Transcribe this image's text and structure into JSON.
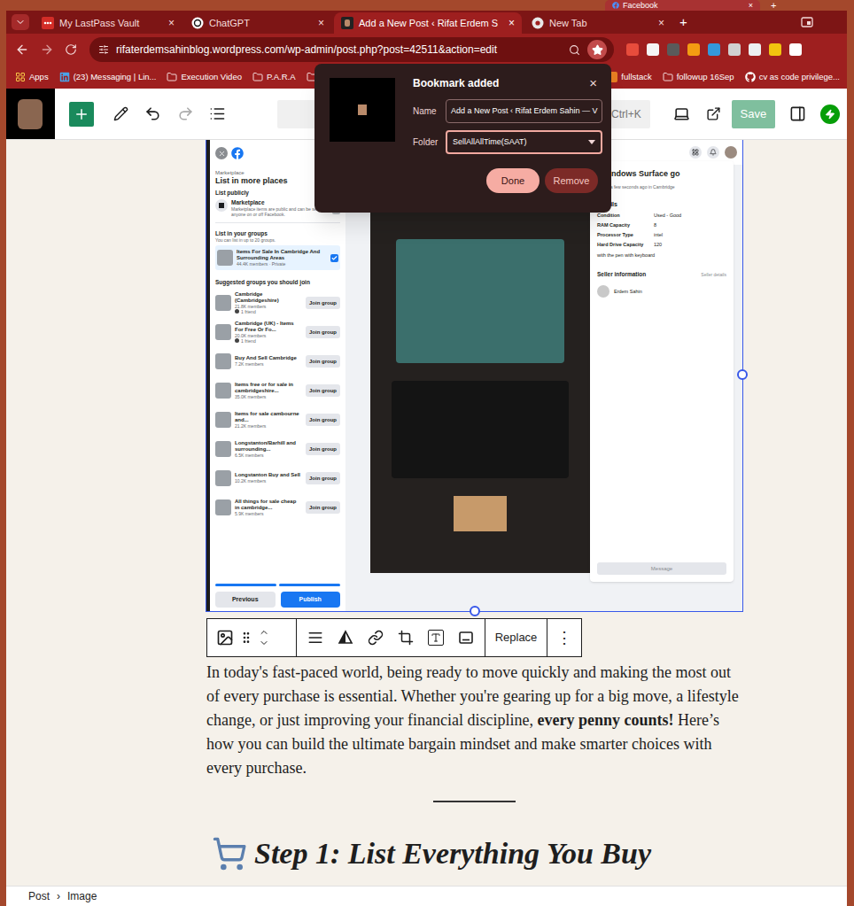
{
  "other_window": {
    "tab": "Facebook",
    "close": "×",
    "new_tab": "+"
  },
  "browser": {
    "tabs": [
      {
        "label": "My LastPass Vault",
        "selected": false
      },
      {
        "label": "ChatGPT",
        "selected": false
      },
      {
        "label": "Add a New Post ‹ Rifat Erdem S",
        "selected": true
      },
      {
        "label": "New Tab",
        "selected": false
      }
    ],
    "tab_close": "×",
    "new_tab": "+",
    "url": "rifaterdemsahinblog.wordpress.com/wp-admin/post.php?post=42511&action=edit",
    "bookmarked": true,
    "bookmarks_left": [
      {
        "label": "Apps",
        "kind": "apps"
      },
      {
        "label": "(23) Messaging | Lin...",
        "kind": "linkedin"
      },
      {
        "label": "Execution Video",
        "kind": "folder"
      },
      {
        "label": "P.A.R.A",
        "kind": "folder"
      }
    ],
    "bookmarks_right": [
      {
        "label": "fullstack",
        "kind": "site"
      },
      {
        "label": "followup 16Sep",
        "kind": "folder"
      },
      {
        "label": "cv as code privilege...",
        "kind": "github"
      }
    ]
  },
  "bookmark_popup": {
    "title": "Bookmark added",
    "close": "×",
    "name_label": "Name",
    "name_value": "Add a New Post ‹ Rifat Erdem Sahin — V",
    "folder_label": "Folder",
    "folder_value": "SellAllAllTime(SAAT)",
    "buttons": [
      {
        "label": "Done",
        "primary": true
      },
      {
        "label": "Remove",
        "primary": false
      }
    ]
  },
  "editor_toolbar": {
    "shortcut": "Ctrl+K",
    "save": {
      "label": "Save",
      "disabled": true
    }
  },
  "listing_screenshot": {
    "left": {
      "header": "Marketplace",
      "title": "List in more places",
      "list_publicly": "List publicly",
      "marketplace": {
        "name": "Marketplace",
        "description": "Marketplace items are public and can be seen by anyone on or off Facebook.",
        "checked": true,
        "disabled": true
      },
      "groups_heading": "List in your groups",
      "groups_sub": "You can list in up to 20 groups.",
      "my_groups": [
        {
          "name": "Items For Sale In Cambridge And Surrounding Areas",
          "meta": "44.4K members · Private",
          "checked": true
        }
      ],
      "suggested_heading": "Suggested groups you should join",
      "suggested": [
        {
          "name": "Cambridge (Cambridgeshire)",
          "members": "21.8K members",
          "friends": "1 friend",
          "action": "Join group"
        },
        {
          "name": "Cambridge (UK) - Items For Free Or Fo...",
          "members": "20.0K members",
          "friends": "1 friend",
          "action": "Join group"
        },
        {
          "name": "Buy And Sell Cambridge",
          "members": "7.2K members",
          "friends": "",
          "action": "Join group"
        },
        {
          "name": "Items free or for sale in cambridgeshire...",
          "members": "35.0K members",
          "friends": "",
          "action": "Join group"
        },
        {
          "name": "Items for sale cambourne and...",
          "members": "21.2K members",
          "friends": "",
          "action": "Join group"
        },
        {
          "name": "Longstanton/Barhill and surrounding...",
          "members": "6.5K members",
          "friends": "",
          "action": "Join group"
        },
        {
          "name": "Longstanton Buy and Sell",
          "members": "10.2K members",
          "friends": "",
          "action": "Join group"
        },
        {
          "name": "All things for sale cheap in cambridge...",
          "members": "5.9K members",
          "friends": "",
          "action": "Join group"
        }
      ],
      "progress_steps": [
        {
          "done": true
        },
        {
          "done": true
        }
      ],
      "buttons": [
        {
          "label": "Previous",
          "primary": false
        },
        {
          "label": "Publish",
          "primary": true
        }
      ]
    },
    "right": {
      "title": "ndows Surface go",
      "listed": "Listed a few seconds ago in Cambridge",
      "details_heading": "Details",
      "details": [
        {
          "label": "Condition",
          "value": "Used - Good"
        },
        {
          "label": "RAM Capacity",
          "value": "8"
        },
        {
          "label": "Processor Type",
          "value": "intel"
        },
        {
          "label": "Hard Drive Capacity",
          "value": "120"
        }
      ],
      "description": "with the pen with keyboard",
      "seller_heading": "Seller information",
      "seller_link": "Seller details",
      "seller": "Erdem Sahin",
      "message": "Message"
    }
  },
  "block_toolbar": {
    "replace": "Replace",
    "more": "⋮"
  },
  "paragraph": [
    {
      "text": "In today's fast-paced world, being ready to move quickly and making the most out of every purchase is essential. Whether you're gearing up for a big move, a lifestyle change, or just improving your financial discipline, ",
      "bold": false
    },
    {
      "text": "every penny counts!",
      "bold": true
    },
    {
      "text": " Here’s how you can build the ultimate bargain mindset and make smarter choices with every purchase.",
      "bold": false
    }
  ],
  "heading": "Step 1: List Everything You Buy",
  "breadcrumb": {
    "items": [
      "Post",
      "Image"
    ],
    "separator": "›"
  }
}
